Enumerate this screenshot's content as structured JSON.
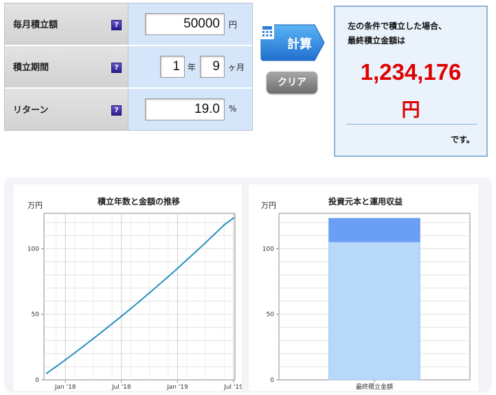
{
  "form": {
    "monthly": {
      "label": "毎月積立額",
      "value": "50000",
      "unit": "円"
    },
    "period": {
      "label": "積立期間",
      "years": "1",
      "years_unit": "年",
      "months": "9",
      "months_unit": "ヶ月"
    },
    "return": {
      "label": "リターン",
      "value": "19.0",
      "unit": "%"
    },
    "help_glyph": "?"
  },
  "buttons": {
    "calc_label": "計算",
    "clear_label": "クリア"
  },
  "result": {
    "desc_line1": "左の条件で積立した場合、",
    "desc_line2": "最終積立金額は",
    "amount": "1,234,176",
    "unit": "円",
    "suffix": "です。"
  },
  "colors": {
    "accent": "#2f8fe0",
    "result_red": "#e00000",
    "line": "#2a8fc0",
    "bar_base": "#b8d8fa",
    "bar_top": "#6a9ff5"
  },
  "chart_data": [
    {
      "type": "line",
      "title": "積立年数と金額の推移",
      "unit_label": "万円",
      "x": [
        "2017-11",
        "2017-12",
        "2018-01",
        "2018-02",
        "2018-03",
        "2018-04",
        "2018-05",
        "2018-06",
        "2018-07",
        "2018-08",
        "2018-09",
        "2018-10",
        "2018-11",
        "2018-12",
        "2019-01",
        "2019-02",
        "2019-03",
        "2019-04",
        "2019-05",
        "2019-06",
        "2019-07"
      ],
      "values": [
        5,
        10.1,
        15.3,
        20.6,
        26.0,
        31.5,
        37.1,
        42.8,
        48.5,
        54.4,
        60.3,
        66.4,
        72.5,
        78.7,
        85.0,
        91.5,
        98.0,
        104.6,
        111.4,
        118.2,
        123.4
      ],
      "xtick_labels": [
        "Jan '18",
        "Jul '18",
        "Jan '19",
        "Jul '19"
      ],
      "xtick_positions": [
        "2018-01",
        "2018-07",
        "2019-01",
        "2019-07"
      ],
      "ylim": [
        0,
        127
      ],
      "yticks": [
        0,
        50,
        100
      ],
      "grid": true
    },
    {
      "type": "bar",
      "title": "投資元本と運用収益",
      "unit_label": "万円",
      "categories": [
        "最終積立金額"
      ],
      "series": [
        {
          "values": [
            105
          ]
        },
        {
          "values": [
            18.4
          ]
        }
      ],
      "stacked": true,
      "ylim": [
        0,
        127
      ],
      "yticks": [
        0,
        50,
        100
      ],
      "grid": true
    }
  ]
}
